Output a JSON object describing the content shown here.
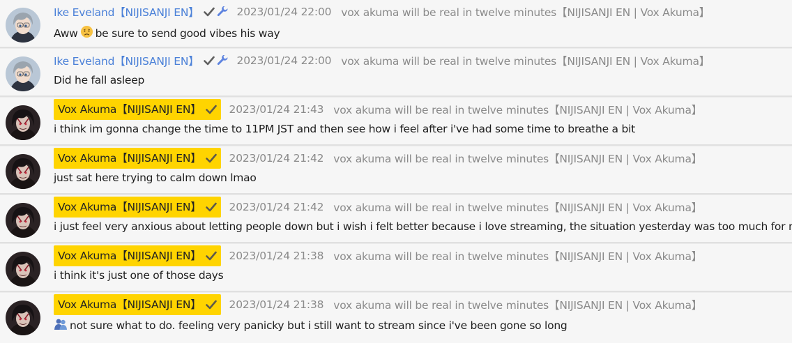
{
  "messages": [
    {
      "author": "Ike Eveland【NIJISANJI EN】",
      "author_type": "member",
      "badges": [
        "verified-check-icon",
        "wrench-moderator-icon"
      ],
      "timestamp": "2023/01/24 22:00",
      "source": "vox akuma will be real in twelve minutes【NIJISANJI EN | Vox Akuma】",
      "text_before": "Aww",
      "emoji": "disappointed-face-emoji",
      "text_after": "be sure to send good vibes his way",
      "avatar": "ike-avatar"
    },
    {
      "author": "Ike Eveland【NIJISANJI EN】",
      "author_type": "member",
      "badges": [
        "verified-check-icon",
        "wrench-moderator-icon"
      ],
      "timestamp": "2023/01/24 22:00",
      "source": "vox akuma will be real in twelve minutes【NIJISANJI EN | Vox Akuma】",
      "text": "Did he fall asleep",
      "avatar": "ike-avatar"
    },
    {
      "author": "Vox Akuma【NIJISANJI EN】",
      "author_type": "owner",
      "badges": [
        "verified-check-icon"
      ],
      "timestamp": "2023/01/24 21:43",
      "source": "vox akuma will be real in twelve minutes【NIJISANJI EN | Vox Akuma】",
      "text": "i think im gonna change the time to 11PM JST and then see how i feel after i've had some time to breathe a bit",
      "avatar": "vox-avatar"
    },
    {
      "author": "Vox Akuma【NIJISANJI EN】",
      "author_type": "owner",
      "badges": [
        "verified-check-icon"
      ],
      "timestamp": "2023/01/24 21:42",
      "source": "vox akuma will be real in twelve minutes【NIJISANJI EN | Vox Akuma】",
      "text": "just sat here trying to calm down lmao",
      "avatar": "vox-avatar"
    },
    {
      "author": "Vox Akuma【NIJISANJI EN】",
      "author_type": "owner",
      "badges": [
        "verified-check-icon"
      ],
      "timestamp": "2023/01/24 21:42",
      "source": "vox akuma will be real in twelve minutes【NIJISANJI EN | Vox Akuma】",
      "text": "i just feel very anxious about letting people down but i wish i felt better because i love streaming, the situation yesterday was too much for me",
      "avatar": "vox-avatar"
    },
    {
      "author": "Vox Akuma【NIJISANJI EN】",
      "author_type": "owner",
      "badges": [
        "verified-check-icon"
      ],
      "timestamp": "2023/01/24 21:38",
      "source": "vox akuma will be real in twelve minutes【NIJISANJI EN | Vox Akuma】",
      "text": "i think it's just one of those days",
      "avatar": "vox-avatar"
    },
    {
      "author": "Vox Akuma【NIJISANJI EN】",
      "author_type": "owner",
      "badges": [
        "verified-check-icon"
      ],
      "timestamp": "2023/01/24 21:38",
      "source": "vox akuma will be real in twelve minutes【NIJISANJI EN | Vox Akuma】",
      "emoji": "people-hugging-emoji",
      "text_after": "not sure what to do. feeling very panicky but i still want to stream since i've been gone so long",
      "avatar": "vox-avatar"
    }
  ],
  "colors": {
    "owner_highlight": "#ffd400",
    "member_name": "#4a80d8",
    "meta_text": "#8a8a8a",
    "message_text": "#1e1e1e",
    "row_background": "#f6f6f6"
  }
}
